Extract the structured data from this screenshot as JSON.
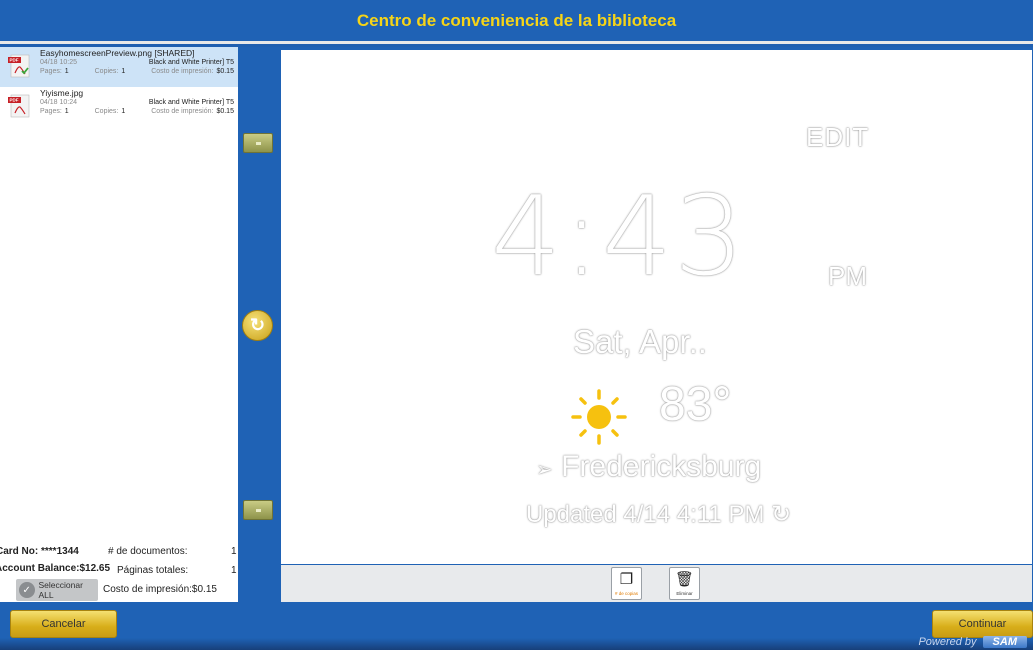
{
  "header": {
    "title": "Centro de conveniencia de la biblioteca"
  },
  "documents": [
    {
      "name": "EasyhomescreenPreview.png [SHARED]",
      "date": "04/18 10:25",
      "printer": "Black and White Printer] T5",
      "pages_label": "Pages:",
      "pages": "1",
      "copies_label": "Copies:",
      "copies": "1",
      "cost_label": "Costo de impresión:",
      "cost": "$0.15",
      "selected": true
    },
    {
      "name": "Yiyisme.jpg",
      "date": "04/18 10:24",
      "printer": "Black and White Printer] T5",
      "pages_label": "Pages:",
      "pages": "1",
      "copies_label": "Copies:",
      "copies": "1",
      "cost_label": "Costo de impresión:",
      "cost": "$0.15",
      "selected": false
    }
  ],
  "summary": {
    "card": "Card No: ****1344",
    "balance": "Account Balance:$12.65",
    "docs_label": "# de documentos:",
    "docs_value": "1",
    "pages_label": "Páginas totales:",
    "pages_value": "1",
    "cost": "Costo de impresión:$0.15",
    "select_all": "Seleccionar ALL"
  },
  "preview": {
    "edit": "EDIT",
    "time": "4:43",
    "ampm": "PM",
    "date": "Sat, Apr..",
    "temp": "83°",
    "city": "Fredericksburg",
    "city_icon": "navigation-arrow-icon",
    "updated": "Updated 4/14 4:11 PM",
    "weather_icon": "sun-icon"
  },
  "actions": {
    "copies_label": "# de copias",
    "delete_label": "Eliminar"
  },
  "footer": {
    "cancel": "Cancelar",
    "continue": "Continuar",
    "powered_by": "Powered by",
    "brand": "SAM"
  },
  "colors": {
    "accent_blue": "#1f62b5",
    "title_yellow": "#f6d417",
    "gold": "#d8ae1a",
    "selected_row": "#cde3f7"
  }
}
